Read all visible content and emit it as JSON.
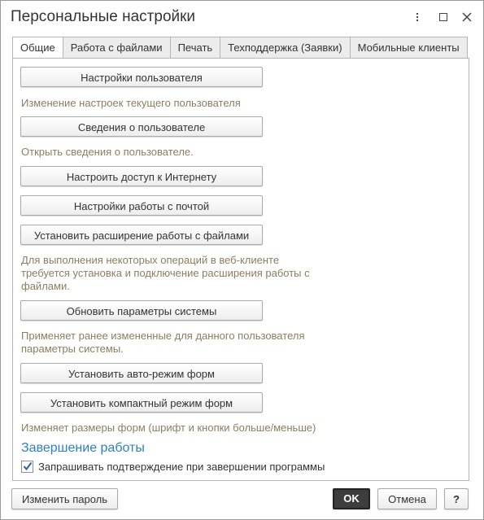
{
  "window": {
    "title": "Персональные настройки",
    "more_icon": "more-vertical-icon",
    "maximize_icon": "maximize-icon",
    "close_icon": "close-icon"
  },
  "tabs": [
    {
      "label": "Общие",
      "active": true
    },
    {
      "label": "Работа с файлами",
      "active": false
    },
    {
      "label": "Печать",
      "active": false
    },
    {
      "label": "Техподдержка (Заявки)",
      "active": false
    },
    {
      "label": "Мобильные клиенты",
      "active": false
    }
  ],
  "general": {
    "user_settings_button": "Настройки пользователя",
    "user_settings_desc": "Изменение настроек текущего пользователя",
    "user_info_button": "Сведения о пользователе",
    "user_info_desc": "Открыть сведения о пользователе.",
    "internet_access_button": "Настроить доступ к Интернету",
    "mail_settings_button": "Настройки работы с почтой",
    "file_extension_button": "Установить расширение работы с файлами",
    "file_extension_desc": "Для выполнения некоторых операций в веб-клиенте требуется установка и подключение расширения работы с файлами.",
    "update_params_button": "Обновить параметры системы",
    "update_params_desc": "Применяет ранее измененные для данного пользователя параметры системы.",
    "auto_mode_button": "Установить авто-режим форм",
    "compact_mode_button": "Установить компактный режим форм",
    "form_mode_desc": "Изменяет размеры форм (шрифт и кнопки больше/меньше)"
  },
  "shutdown": {
    "section_title": "Завершение работы",
    "confirm_exit_label": "Запрашивать подтверждение при завершении программы",
    "confirm_exit_checked": true
  },
  "footer": {
    "change_password": "Изменить пароль",
    "ok": "OK",
    "cancel": "Отмена",
    "help": "?"
  },
  "colors": {
    "description_text": "#8a7e5f",
    "section_title": "#2c7fc4",
    "ok_button_bg": "#3d3d3d"
  }
}
